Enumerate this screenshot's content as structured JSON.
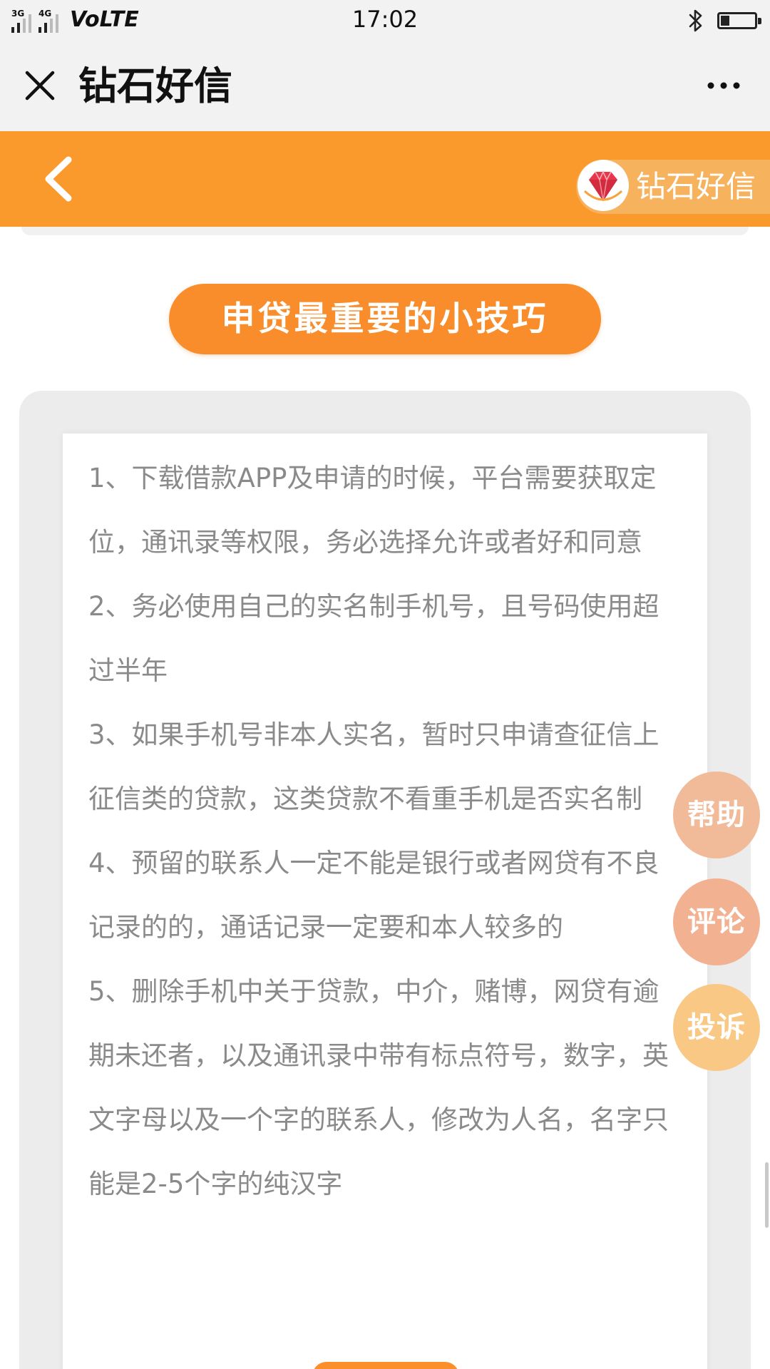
{
  "status_bar": {
    "net_1": "3G",
    "net_2": "4G",
    "carrier_label": "VoLTE",
    "time": "17:02",
    "battery_level": 0.25
  },
  "title_bar": {
    "title": "钻石好信"
  },
  "header": {
    "brand_name": "钻石好信"
  },
  "section": {
    "title": "申贷最重要的小技巧"
  },
  "tips": [
    "1、下载借款APP及申请的时候，平台需要获取定位，通讯录等权限，务必选择允许或者好和同意",
    "2、务必使用自己的实名制手机号，且号码使用超过半年",
    "3、如果手机号非本人实名，暂时只申请查征信上征信类的贷款，这类贷款不看重手机是否实名制",
    "4、预留的联系人一定不能是银行或者网贷有不良记录的的，通话记录一定要和本人较多的",
    "5、删除手机中关于贷款，中介，赌博，网贷有逾期未还者，以及通讯录中带有标点符号，数字，英文字母以及一个字的联系人，修改为人名，名字只能是2-5个字的纯汉字"
  ],
  "float_buttons": {
    "help": "帮助",
    "comment": "评论",
    "report": "投诉"
  },
  "colors": {
    "brand_orange": "#fb9a2c",
    "pill_orange": "#f98d2b",
    "tip_text": "#8a8a8a"
  }
}
